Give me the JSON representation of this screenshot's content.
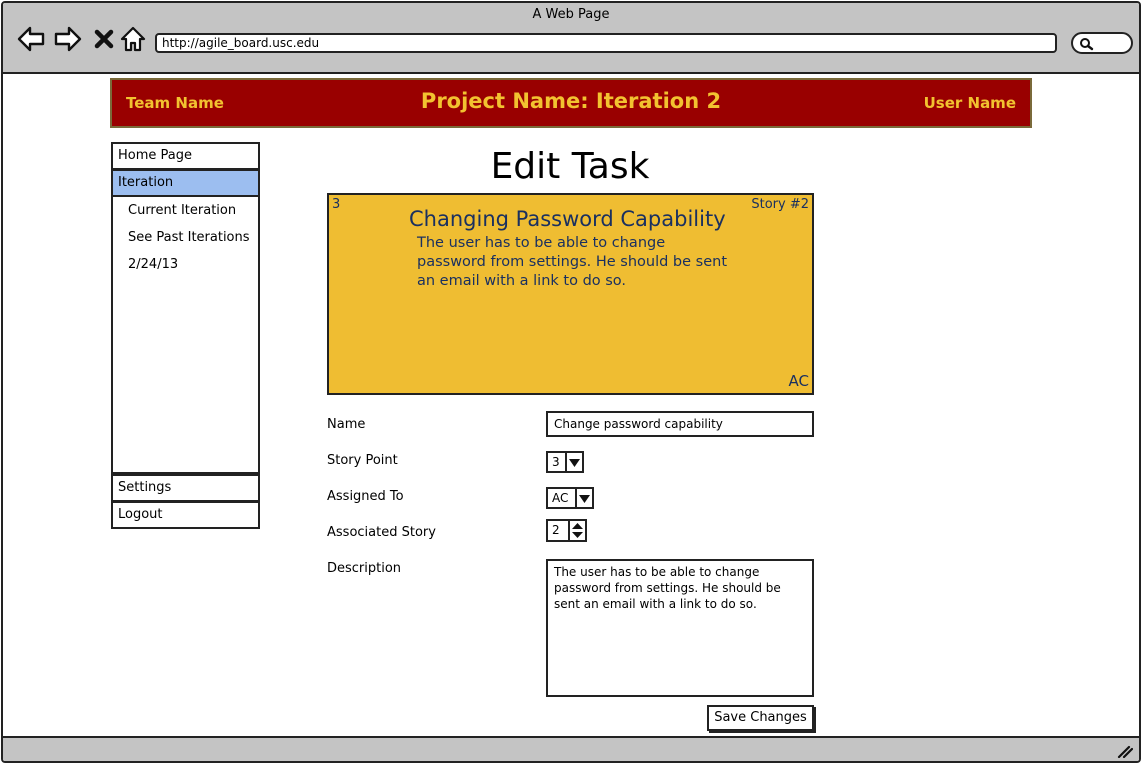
{
  "browser": {
    "window_title": "A Web Page",
    "url": "http://agile_board.usc.edu",
    "icons": [
      "back-arrow-icon",
      "forward-arrow-icon",
      "close-x-icon",
      "home-icon",
      "search-icon",
      "resize-grip-icon"
    ]
  },
  "header": {
    "team_name": "Team Name",
    "project_name": "Project Name: Iteration 2",
    "user_name": "User Name",
    "background_color": "#990000",
    "text_color": "#f2c230"
  },
  "sidebar": {
    "home": "Home Page",
    "iteration": "Iteration",
    "iteration_items": [
      "Current Iteration",
      "See Past Iterations",
      "2/24/13"
    ],
    "settings": "Settings",
    "logout": "Logout"
  },
  "page": {
    "title": "Edit Task"
  },
  "story_card": {
    "points": "3",
    "story_number": "Story #2",
    "title": "Changing Password Capability",
    "description": "The user has to be able to change password from settings. He should be sent an email with a link to do so.",
    "owner": "AC",
    "background_color": "#efbd32"
  },
  "form": {
    "name_label": "Name",
    "name_value": "Change password capability",
    "story_point_label": "Story Point",
    "story_point_value": "3",
    "assigned_to_label": "Assigned To",
    "assigned_to_value": "AC",
    "associated_story_label": "Associated Story",
    "associated_story_value": "2",
    "description_label": "Description",
    "description_value": "The user has to be able to change password from settings. He should be sent an email with a link to do so.",
    "save_label": "Save Changes"
  }
}
